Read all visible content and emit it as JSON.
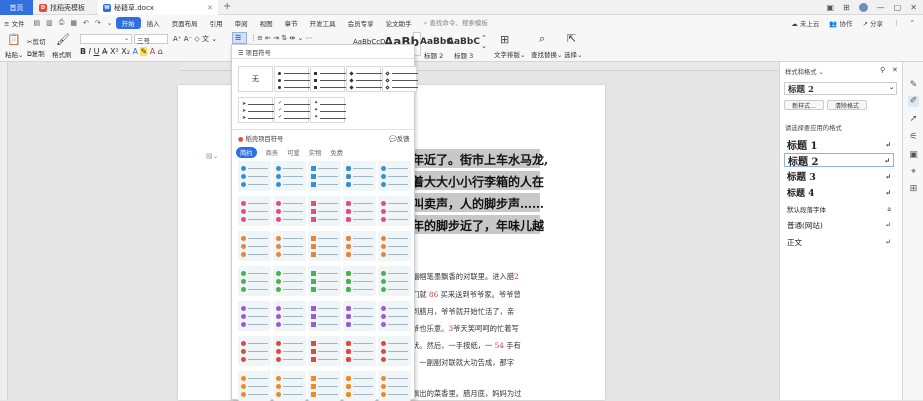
{
  "tabs": [
    {
      "label": "首页"
    },
    {
      "label": "找稻壳模板"
    },
    {
      "label": "秘籍草.docx"
    }
  ],
  "menu": {
    "left_items": [
      "文件",
      "开始",
      "插入",
      "页面布局",
      "引用",
      "审阅",
      "视图",
      "章节",
      "开发工具",
      "会员专享",
      "论文助手"
    ],
    "search_placeholder": "查找命令、搜索模板",
    "right_items": [
      "未上云",
      "协作",
      "分享"
    ]
  },
  "ribbon": {
    "paste": "粘贴",
    "cut": "剪切",
    "copy": "复制",
    "format_brush": "格式刷",
    "font_size": "三号",
    "bullet_label": "项目符号",
    "styles": [
      {
        "preview": "AaBbCcD",
        "label": "正文"
      },
      {
        "preview": "AaBb",
        "label": "标题 1"
      },
      {
        "preview": "AaBbC",
        "label": "标题 2"
      },
      {
        "preview": "AaBbC",
        "label": "标题 3"
      }
    ],
    "text_tools": "文字排版",
    "find_replace": "查找替换",
    "select": "选择"
  },
  "dropdown": {
    "header": "项目符号",
    "none_label": "无",
    "section_title": "稻壳项目符号",
    "feedback": "反馈",
    "filters": [
      "简约",
      "商务",
      "可爱",
      "实物",
      "免费"
    ],
    "active_filter": "简约"
  },
  "document": {
    "highlight_lines": [
      "年近了。街市上车水马龙,",
      "着大大小小行李箱的人在",
      "叫卖声，人的脚步声……",
      "年的脚步近了，年味儿越"
    ],
    "body_lines": [
      [
        "福帼笔墨飘香的对联里。进入腊",
        "2",
        ""
      ],
      [
        "们就",
        "86",
        "买来送到爷爷家。爷爷曾"
      ],
      [
        "到腊月，爷爷就开始忙活了，亲",
        "",
        ""
      ],
      [
        "爷也乐意。",
        "3",
        "爷天笑呵呵的忙着写"
      ],
      [
        "状。然后，一手按纸，一",
        "54",
        "手有"
      ],
      [
        "，一副副对联就大功告成，那字",
        "",
        ""
      ],
      [
        "飘出的菜香里。腊月底，妈妈为过",
        "",
        ""
      ]
    ]
  },
  "pane": {
    "title": "样式和格式",
    "current_style": "标题 2",
    "new_style": "新样式...",
    "clear_format": "清除格式",
    "apply_label": "请选择要应用的格式",
    "styles": [
      {
        "name": "标题 1"
      },
      {
        "name": "标题 2"
      },
      {
        "name": "标题 3"
      },
      {
        "name": "标题 4"
      },
      {
        "name": "默认段落字体"
      },
      {
        "name": "普通(网站)"
      },
      {
        "name": "正文"
      }
    ]
  },
  "colors": {
    "accent": "#2f6fde",
    "highlight": "#c8c8c8",
    "red_number": "#d23b3b"
  }
}
